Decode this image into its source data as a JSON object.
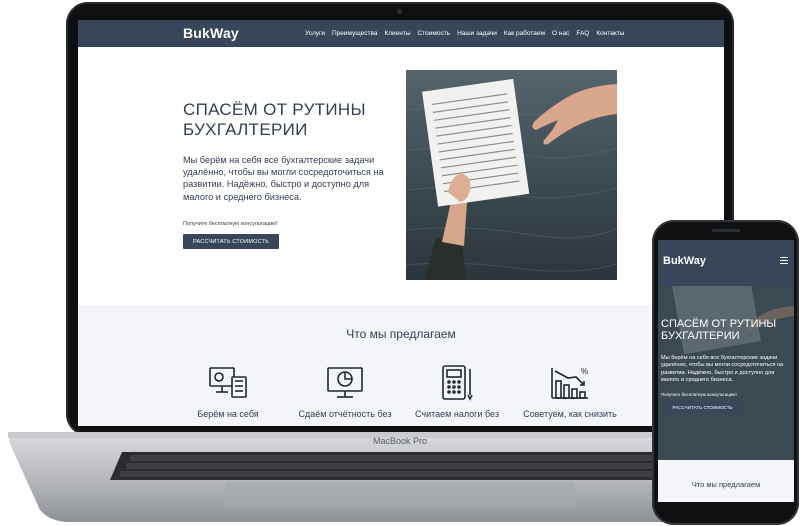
{
  "site": {
    "logo": "BukWay",
    "menu": [
      "Услуги",
      "Преимущества",
      "Клиенты",
      "Стоимость",
      "Наши задачи",
      "Как работаем",
      "О нас",
      "FAQ",
      "Контакты"
    ],
    "hero": {
      "title": "СПАСЁМ ОТ РУТИНЫ БУХГАЛТЕРИИ",
      "text": "Мы берём на себя все бухгалтерские задачи удалённо, чтобы вы могли сосредоточиться на развитии. Надёжно, быстро и доступно для малого и среднего бизнеса.",
      "consult": "Получите бесплатную консультацию!",
      "button": "РАССЧИТАТЬ СТОИМОСТЬ"
    },
    "offer": {
      "title": "Что мы предлагаем",
      "services": [
        {
          "label": "Берём на себя",
          "icon": "accounting-computer-icon"
        },
        {
          "label": "Сдаём отчётность без",
          "icon": "report-monitor-icon"
        },
        {
          "label": "Считаем налоги без",
          "icon": "calculator-icon"
        },
        {
          "label": "Советуем, как снизить",
          "icon": "chart-down-percent-icon"
        }
      ]
    }
  },
  "device": {
    "laptop_brand": "MacBook Pro"
  },
  "colors": {
    "nav": "#39465a",
    "text": "#344052",
    "section_bg": "#f4f5f9"
  }
}
